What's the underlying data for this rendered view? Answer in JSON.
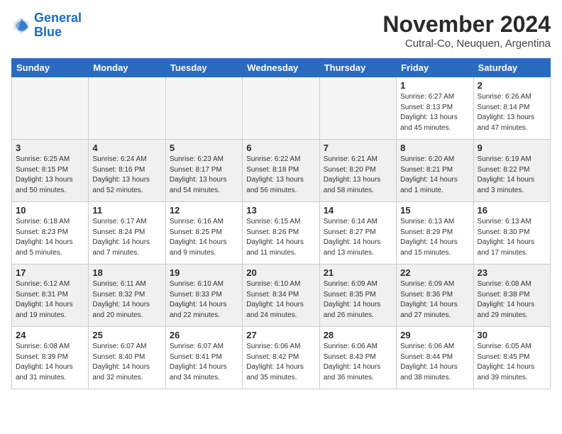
{
  "header": {
    "logo_line1": "General",
    "logo_line2": "Blue",
    "month": "November 2024",
    "location": "Cutral-Co, Neuquen, Argentina"
  },
  "weekdays": [
    "Sunday",
    "Monday",
    "Tuesday",
    "Wednesday",
    "Thursday",
    "Friday",
    "Saturday"
  ],
  "weeks": [
    [
      {
        "day": "",
        "info": ""
      },
      {
        "day": "",
        "info": ""
      },
      {
        "day": "",
        "info": ""
      },
      {
        "day": "",
        "info": ""
      },
      {
        "day": "",
        "info": ""
      },
      {
        "day": "1",
        "info": "Sunrise: 6:27 AM\nSunset: 8:13 PM\nDaylight: 13 hours\nand 45 minutes."
      },
      {
        "day": "2",
        "info": "Sunrise: 6:26 AM\nSunset: 8:14 PM\nDaylight: 13 hours\nand 47 minutes."
      }
    ],
    [
      {
        "day": "3",
        "info": "Sunrise: 6:25 AM\nSunset: 8:15 PM\nDaylight: 13 hours\nand 50 minutes."
      },
      {
        "day": "4",
        "info": "Sunrise: 6:24 AM\nSunset: 8:16 PM\nDaylight: 13 hours\nand 52 minutes."
      },
      {
        "day": "5",
        "info": "Sunrise: 6:23 AM\nSunset: 8:17 PM\nDaylight: 13 hours\nand 54 minutes."
      },
      {
        "day": "6",
        "info": "Sunrise: 6:22 AM\nSunset: 8:18 PM\nDaylight: 13 hours\nand 56 minutes."
      },
      {
        "day": "7",
        "info": "Sunrise: 6:21 AM\nSunset: 8:20 PM\nDaylight: 13 hours\nand 58 minutes."
      },
      {
        "day": "8",
        "info": "Sunrise: 6:20 AM\nSunset: 8:21 PM\nDaylight: 14 hours\nand 1 minute."
      },
      {
        "day": "9",
        "info": "Sunrise: 6:19 AM\nSunset: 8:22 PM\nDaylight: 14 hours\nand 3 minutes."
      }
    ],
    [
      {
        "day": "10",
        "info": "Sunrise: 6:18 AM\nSunset: 8:23 PM\nDaylight: 14 hours\nand 5 minutes."
      },
      {
        "day": "11",
        "info": "Sunrise: 6:17 AM\nSunset: 8:24 PM\nDaylight: 14 hours\nand 7 minutes."
      },
      {
        "day": "12",
        "info": "Sunrise: 6:16 AM\nSunset: 8:25 PM\nDaylight: 14 hours\nand 9 minutes."
      },
      {
        "day": "13",
        "info": "Sunrise: 6:15 AM\nSunset: 8:26 PM\nDaylight: 14 hours\nand 11 minutes."
      },
      {
        "day": "14",
        "info": "Sunrise: 6:14 AM\nSunset: 8:27 PM\nDaylight: 14 hours\nand 13 minutes."
      },
      {
        "day": "15",
        "info": "Sunrise: 6:13 AM\nSunset: 8:29 PM\nDaylight: 14 hours\nand 15 minutes."
      },
      {
        "day": "16",
        "info": "Sunrise: 6:13 AM\nSunset: 8:30 PM\nDaylight: 14 hours\nand 17 minutes."
      }
    ],
    [
      {
        "day": "17",
        "info": "Sunrise: 6:12 AM\nSunset: 8:31 PM\nDaylight: 14 hours\nand 19 minutes."
      },
      {
        "day": "18",
        "info": "Sunrise: 6:11 AM\nSunset: 8:32 PM\nDaylight: 14 hours\nand 20 minutes."
      },
      {
        "day": "19",
        "info": "Sunrise: 6:10 AM\nSunset: 8:33 PM\nDaylight: 14 hours\nand 22 minutes."
      },
      {
        "day": "20",
        "info": "Sunrise: 6:10 AM\nSunset: 8:34 PM\nDaylight: 14 hours\nand 24 minutes."
      },
      {
        "day": "21",
        "info": "Sunrise: 6:09 AM\nSunset: 8:35 PM\nDaylight: 14 hours\nand 26 minutes."
      },
      {
        "day": "22",
        "info": "Sunrise: 6:09 AM\nSunset: 8:36 PM\nDaylight: 14 hours\nand 27 minutes."
      },
      {
        "day": "23",
        "info": "Sunrise: 6:08 AM\nSunset: 8:38 PM\nDaylight: 14 hours\nand 29 minutes."
      }
    ],
    [
      {
        "day": "24",
        "info": "Sunrise: 6:08 AM\nSunset: 8:39 PM\nDaylight: 14 hours\nand 31 minutes."
      },
      {
        "day": "25",
        "info": "Sunrise: 6:07 AM\nSunset: 8:40 PM\nDaylight: 14 hours\nand 32 minutes."
      },
      {
        "day": "26",
        "info": "Sunrise: 6:07 AM\nSunset: 8:41 PM\nDaylight: 14 hours\nand 34 minutes."
      },
      {
        "day": "27",
        "info": "Sunrise: 6:06 AM\nSunset: 8:42 PM\nDaylight: 14 hours\nand 35 minutes."
      },
      {
        "day": "28",
        "info": "Sunrise: 6:06 AM\nSunset: 8:43 PM\nDaylight: 14 hours\nand 36 minutes."
      },
      {
        "day": "29",
        "info": "Sunrise: 6:06 AM\nSunset: 8:44 PM\nDaylight: 14 hours\nand 38 minutes."
      },
      {
        "day": "30",
        "info": "Sunrise: 6:05 AM\nSunset: 8:45 PM\nDaylight: 14 hours\nand 39 minutes."
      }
    ]
  ]
}
